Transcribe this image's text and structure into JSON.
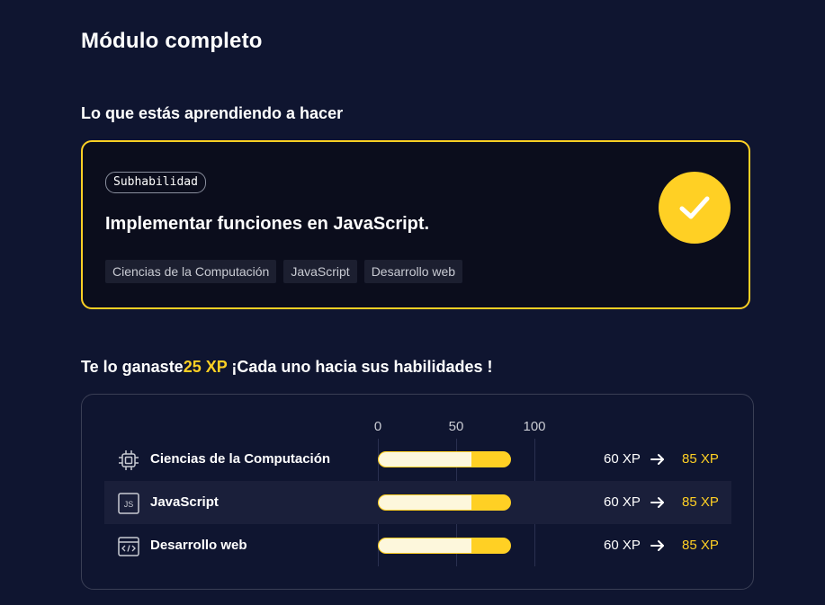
{
  "page_title": "Módulo completo",
  "section_title": "Lo que estás aprendiendo a hacer",
  "skill_card": {
    "badge": "Subhabilidad",
    "title": "Implementar funciones en JavaScript.",
    "tags": [
      "Ciencias de la Computación",
      "JavaScript",
      "Desarrollo web"
    ],
    "status_icon": "check-icon"
  },
  "earned": {
    "prefix": "Te lo ganaste",
    "xp": "25 XP",
    "suffix": " ¡Cada uno hacia sus habilidades !"
  },
  "xp_scale": [
    "0",
    "50",
    "100"
  ],
  "skills": [
    {
      "name": "Ciencias de la Computación",
      "icon": "chip-icon",
      "from": "60 XP",
      "to": "85 XP",
      "progress_before": 60,
      "progress_after": 85
    },
    {
      "name": "JavaScript",
      "icon": "js-file-icon",
      "from": "60 XP",
      "to": "85 XP",
      "progress_before": 60,
      "progress_after": 85
    },
    {
      "name": "Desarrollo web",
      "icon": "code-window-icon",
      "from": "60 XP",
      "to": "85 XP",
      "progress_before": 60,
      "progress_after": 85
    }
  ],
  "colors": {
    "accent": "#ffd024",
    "background": "#0f1530",
    "card": "#0b0d1c"
  }
}
